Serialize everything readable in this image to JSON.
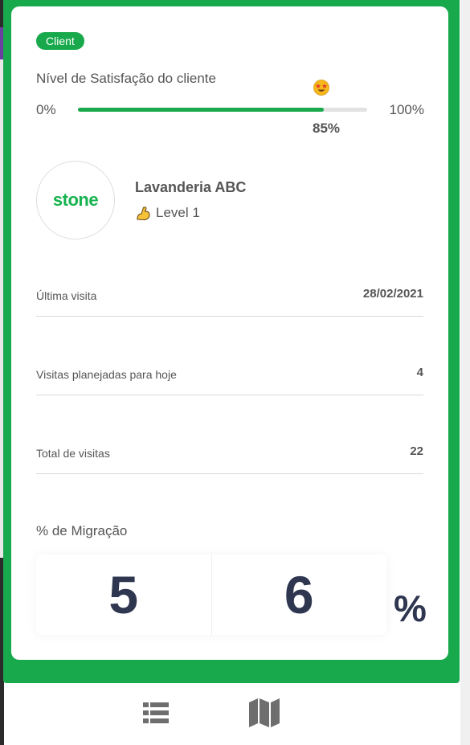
{
  "badge": "Client",
  "satisfaction": {
    "title": "Nível de Satisfação do cliente",
    "min_label": "0%",
    "max_label": "100%",
    "value_label": "85%",
    "fraction": 0.85,
    "emoji_icon": "star-struck-face-icon"
  },
  "client": {
    "logo_text": "stone",
    "name": "Lavanderia ABC",
    "level_icon": "flexed-biceps-icon",
    "level": "Level 1"
  },
  "stats": [
    {
      "label": "Última visita",
      "value": "28/02/2021"
    },
    {
      "label": "Visitas planejadas para hoje",
      "value": "4"
    },
    {
      "label": "Total de visitas",
      "value": "22"
    }
  ],
  "migration": {
    "title": "% de Migração",
    "digit1": "5",
    "digit2": "6",
    "unit": "%"
  },
  "nav": {
    "list_icon": "list-icon",
    "map_icon": "map-icon"
  },
  "colors": {
    "brand_green": "#17a94b",
    "text_dark": "#2e3650",
    "text_gray": "#555555"
  }
}
